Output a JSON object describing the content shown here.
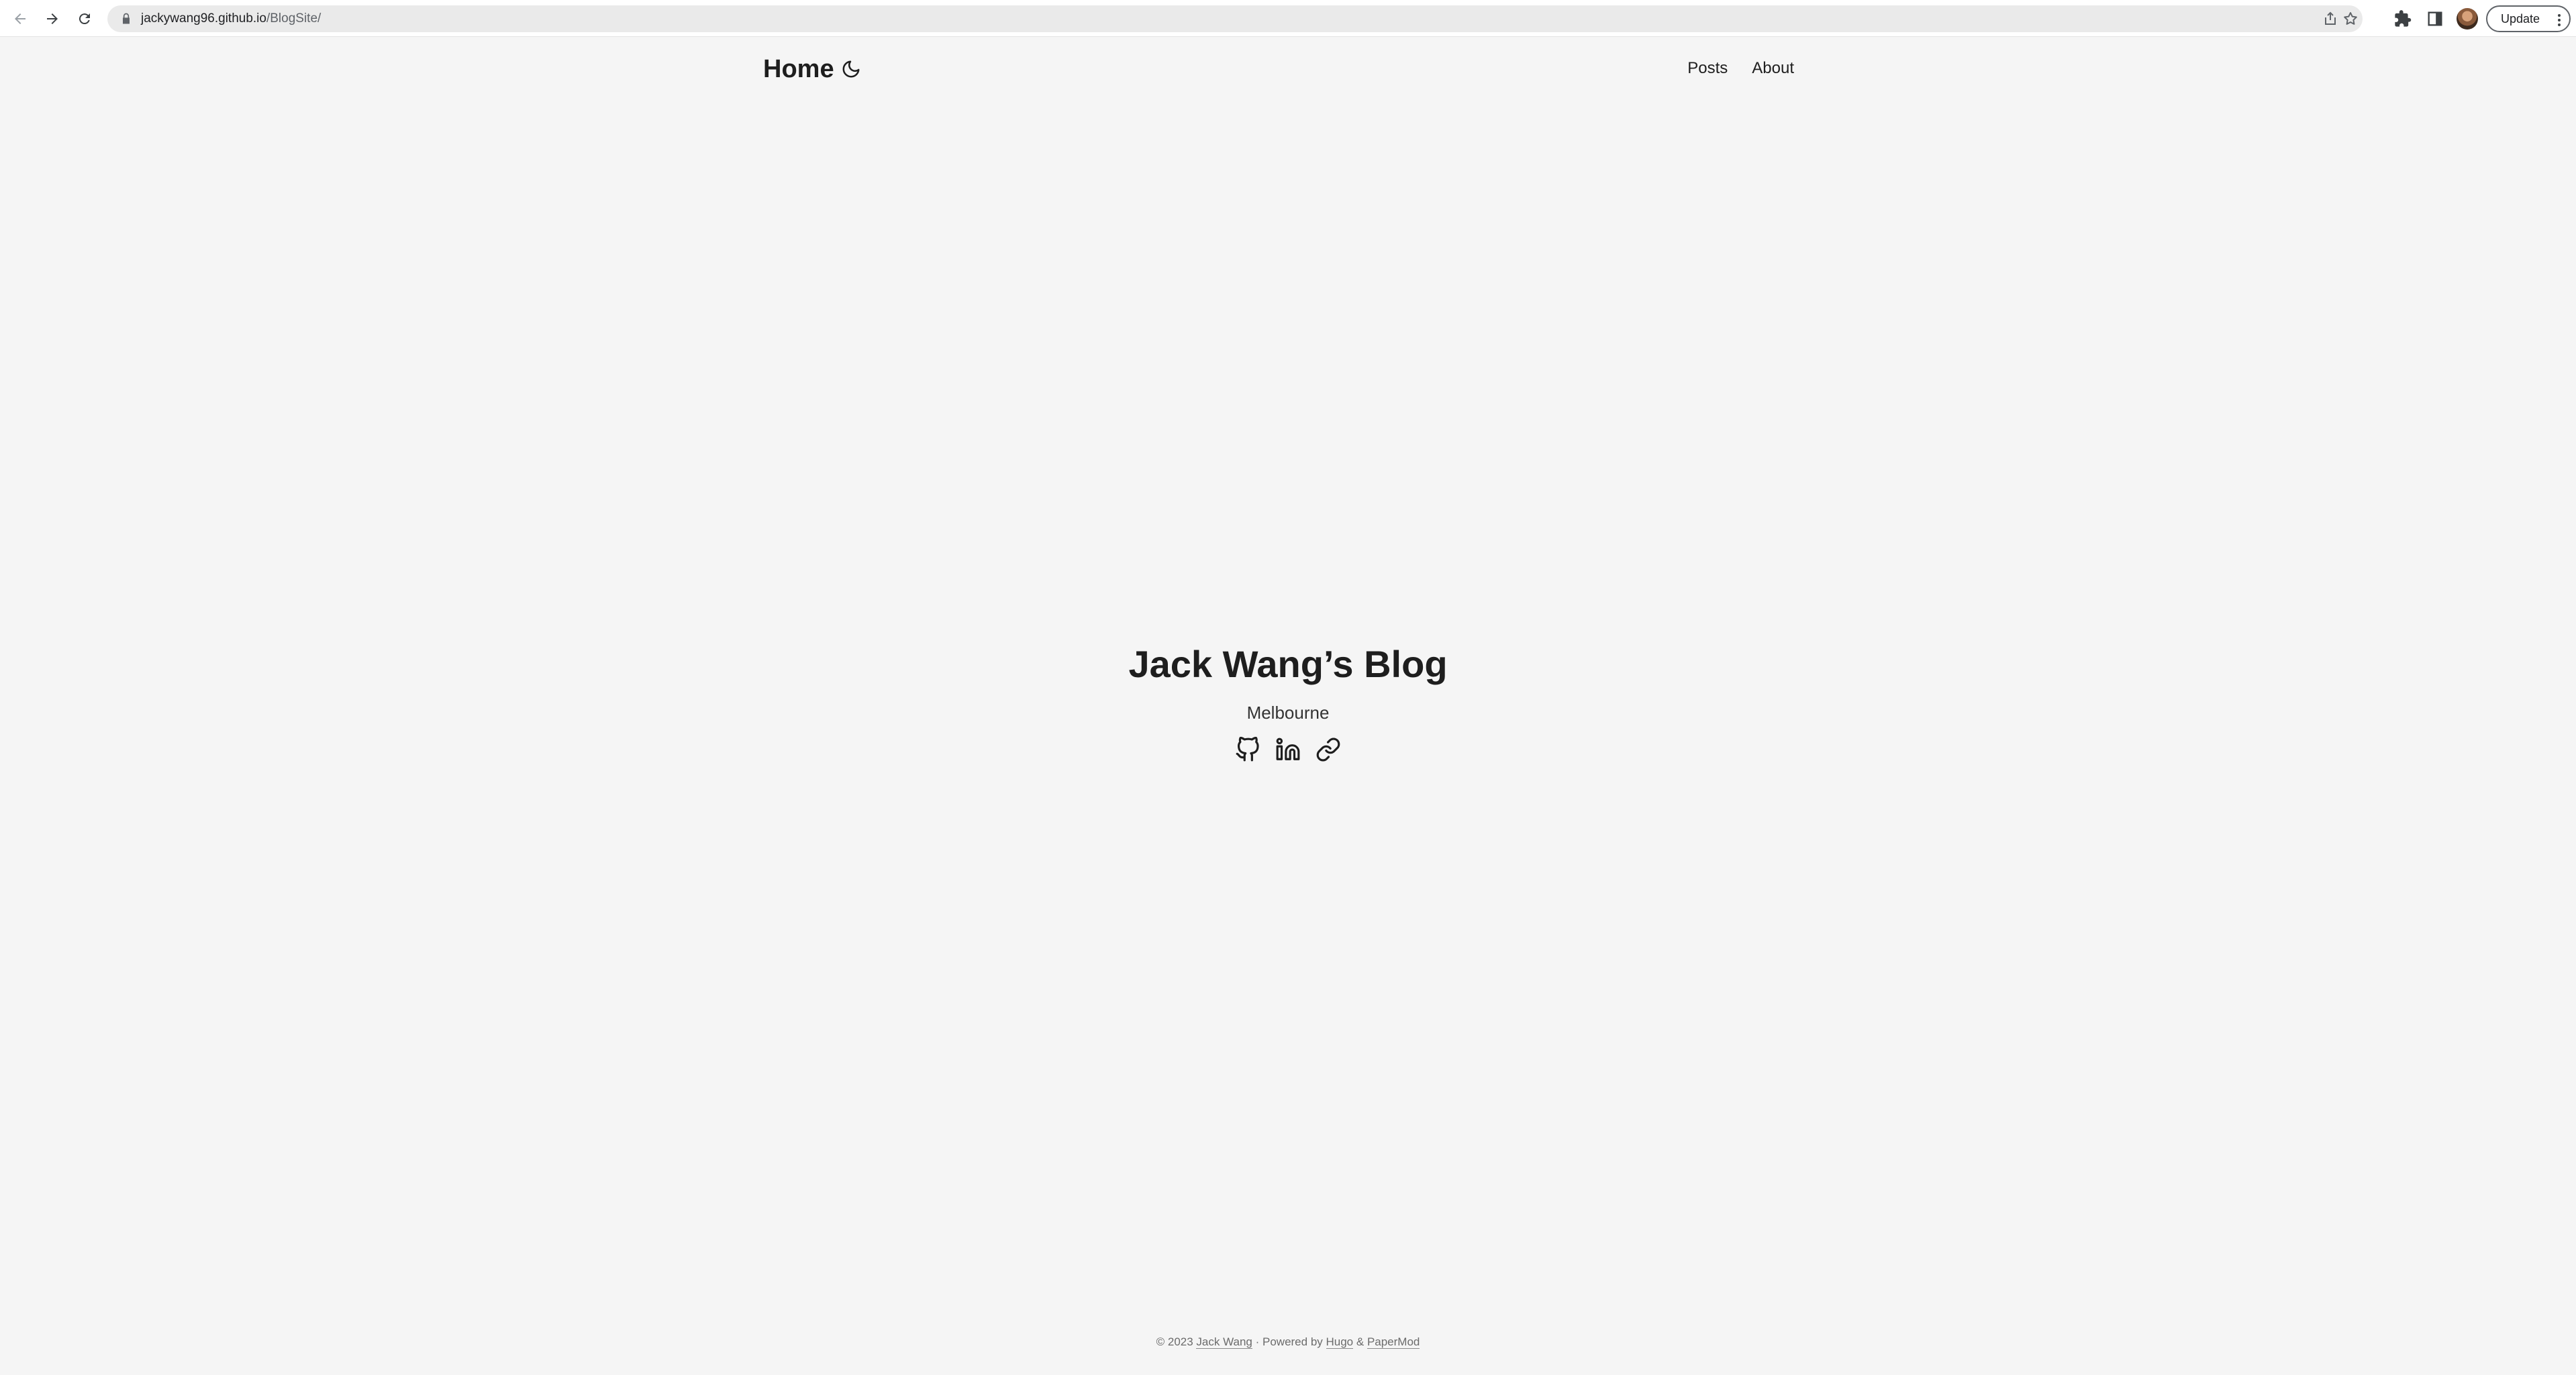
{
  "browser": {
    "url_host": "jackywang96.github.io",
    "url_path": "/BlogSite/",
    "update_label": "Update",
    "icons": {
      "back": "back-arrow-icon",
      "forward": "forward-arrow-icon",
      "reload": "reload-icon",
      "lock": "lock-icon",
      "share": "share-icon",
      "bookmark": "star-icon",
      "extensions": "puzzle-icon",
      "side_panel": "side-panel-icon",
      "profile": "avatar",
      "menu": "kebab-menu-icon"
    }
  },
  "header": {
    "logo": "Home",
    "theme_toggle_icon": "moon-icon",
    "menu": [
      {
        "label": "Posts"
      },
      {
        "label": "About"
      }
    ]
  },
  "home": {
    "title": "Jack Wang’s Blog",
    "subtitle": "Melbourne",
    "social": [
      {
        "icon": "github-icon"
      },
      {
        "icon": "linkedin-icon"
      },
      {
        "icon": "link-icon"
      }
    ]
  },
  "footer": {
    "copyright": "© 2023 ",
    "author": "Jack Wang",
    "powered_by": " · Powered by ",
    "engine": "Hugo",
    "amp": " & ",
    "theme": "PaperMod"
  },
  "colors": {
    "page_background": "#f5f5f5",
    "text_primary": "#1e1e1e",
    "text_secondary": "#6b6b6b"
  }
}
